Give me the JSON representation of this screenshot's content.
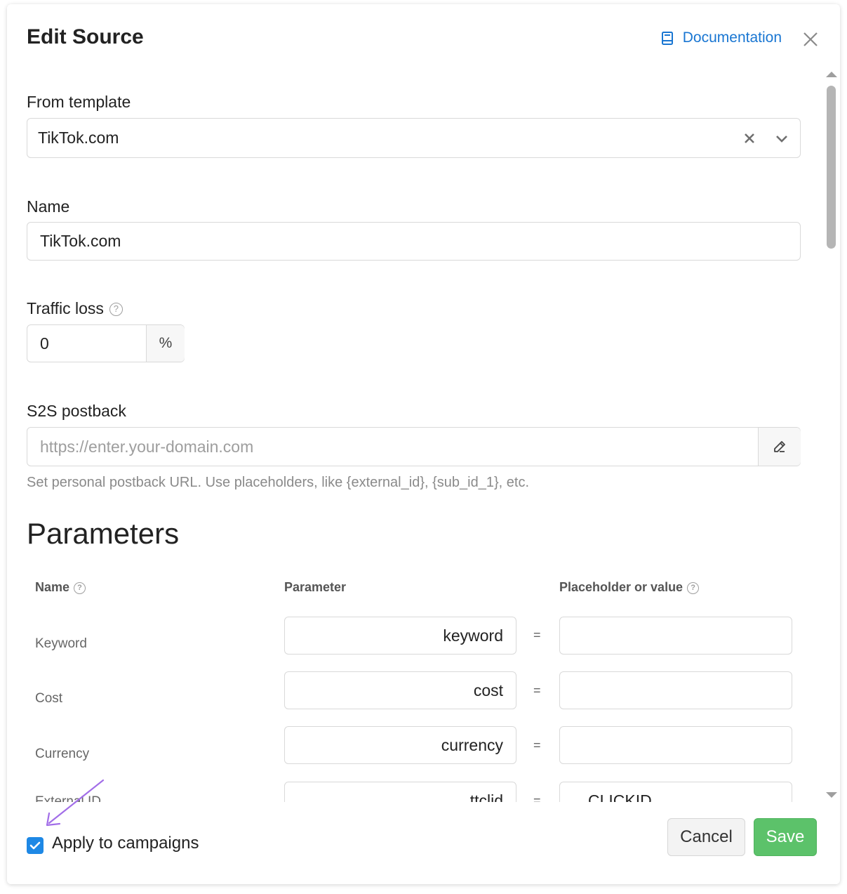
{
  "header": {
    "title": "Edit Source",
    "documentation_label": "Documentation"
  },
  "colors": {
    "accent": "#1976d2",
    "checkbox": "#1e88e5",
    "save": "#5cc26a",
    "annotation_arrow": "#a26ee8"
  },
  "template": {
    "label": "From template",
    "value": "TikTok.com"
  },
  "name": {
    "label": "Name",
    "value": "TikTok.com"
  },
  "traffic_loss": {
    "label": "Traffic loss",
    "help": "?",
    "value": "0",
    "unit": "%"
  },
  "postback": {
    "label": "S2S postback",
    "placeholder": "https://enter.your-domain.com",
    "hint": "Set personal postback URL. Use placeholders, like {external_id}, {sub_id_1}, etc."
  },
  "parameters": {
    "title": "Parameters",
    "columns": {
      "name": "Name",
      "parameter": "Parameter",
      "value": "Placeholder or value"
    },
    "help": "?",
    "equals": "=",
    "rows": [
      {
        "name": "Keyword",
        "parameter": "keyword",
        "value": ""
      },
      {
        "name": "Cost",
        "parameter": "cost",
        "value": ""
      },
      {
        "name": "Currency",
        "parameter": "currency",
        "value": ""
      },
      {
        "name": "External ID",
        "parameter": "ttclid",
        "value": "CLICKID"
      }
    ]
  },
  "footer": {
    "apply_label": "Apply to campaigns",
    "apply_checked": true,
    "cancel_label": "Cancel",
    "save_label": "Save"
  }
}
